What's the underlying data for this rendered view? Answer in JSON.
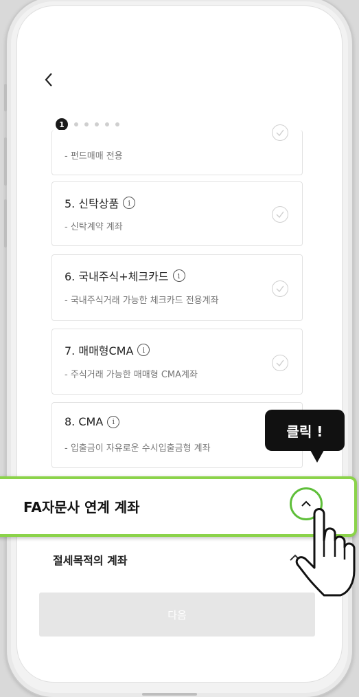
{
  "header": {
    "back_icon": "chevron-left-icon"
  },
  "stepper": {
    "active_step": "1",
    "total_steps": 6
  },
  "cards": [
    {
      "title": "",
      "desc": "- 펀드매매 전용"
    },
    {
      "title": "5. 신탁상품",
      "desc": "- 신탁계약 계좌"
    },
    {
      "title": "6. 국내주식+체크카드",
      "desc": "- 국내주식거래 가능한 체크카드 전용계좌"
    },
    {
      "title": "7. 매매형CMA",
      "desc": "- 주식거래 가능한 매매형 CMA계좌"
    },
    {
      "title": "8. CMA",
      "desc": "- 입출금이 자유로운 수시입출금형 계좌"
    }
  ],
  "info_glyph": "i",
  "section_fa": {
    "label": "FA자문사 연계 계좌"
  },
  "section_tax": {
    "label": "절세목적의 계좌"
  },
  "next_button": {
    "label": "다음"
  },
  "tooltip": {
    "label": "클릭 !"
  },
  "colors": {
    "highlight": "#8bd34a",
    "circle": "#5fbf3a",
    "tooltip_bg": "#111111",
    "next_btn_bg": "#e6e6e6"
  }
}
